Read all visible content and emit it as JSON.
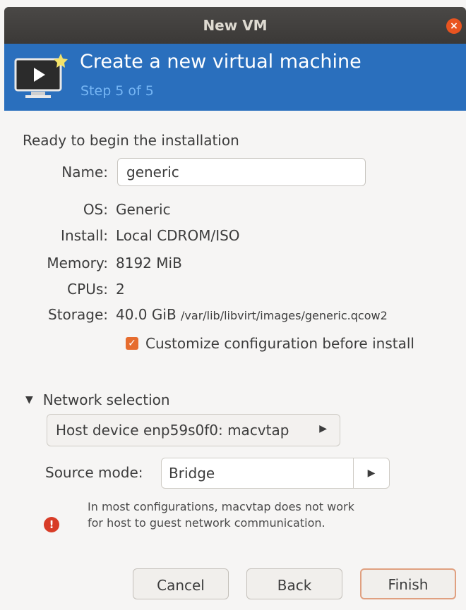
{
  "window": {
    "title": "New VM",
    "close_glyph": "×"
  },
  "header": {
    "title": "Create a new virtual machine",
    "step": "Step 5 of 5",
    "icon": "monitor-play-icon"
  },
  "summary": {
    "intro": "Ready to begin the installation",
    "name_label": "Name:",
    "name_value": "generic",
    "os_label": "OS:",
    "os_value": "Generic",
    "install_label": "Install:",
    "install_value": "Local CDROM/ISO",
    "memory_label": "Memory:",
    "memory_value": "8192 MiB",
    "cpus_label": "CPUs:",
    "cpus_value": "2",
    "storage_label": "Storage:",
    "storage_size": "40.0 GiB",
    "storage_path": "/var/lib/libvirt/images/generic.qcow2",
    "customize_label": "Customize configuration before install",
    "customize_checked": true
  },
  "network": {
    "expander_label": "Network selection",
    "device": "Host device enp59s0f0: macvtap",
    "source_mode_label": "Source mode:",
    "source_mode_value": "Bridge",
    "warning": "In most configurations, macvtap does not work for host to guest network communication."
  },
  "buttons": {
    "cancel": "Cancel",
    "back": "Back",
    "finish": "Finish"
  },
  "colors": {
    "header_bg": "#2a6fbd",
    "accent": "#e66c2e",
    "error": "#d83c27"
  }
}
